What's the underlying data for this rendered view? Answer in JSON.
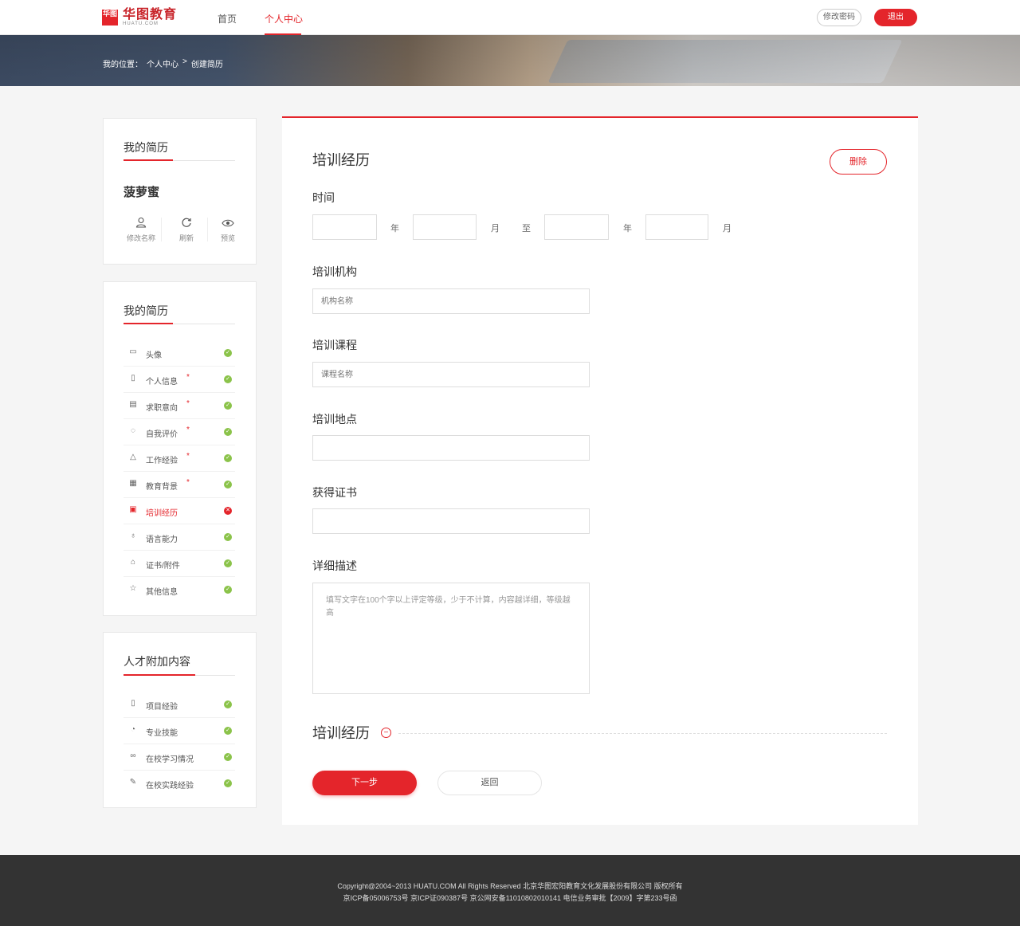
{
  "header": {
    "logo_mark": "华图",
    "logo_cn": "华图教育",
    "logo_en": "HUATU.COM",
    "nav": [
      "首页",
      "个人中心"
    ],
    "change_password": "修改密码",
    "logout": "退出"
  },
  "breadcrumb": {
    "prefix": "我的位置：",
    "level1": "个人中心",
    "sep": ">",
    "level2": "创建简历"
  },
  "profile_card": {
    "title": "我的简历",
    "username": "菠萝蜜",
    "actions": [
      {
        "label": "修改名称",
        "icon": "user-icon"
      },
      {
        "label": "刷新",
        "icon": "refresh-icon"
      },
      {
        "label": "预览",
        "icon": "eye-icon"
      }
    ]
  },
  "resume_menu": {
    "title": "我的简历",
    "items": [
      {
        "label": "头像",
        "required": false,
        "status": "ok"
      },
      {
        "label": "个人信息",
        "required": true,
        "status": "ok"
      },
      {
        "label": "求职意向",
        "required": true,
        "status": "ok"
      },
      {
        "label": "自我评价",
        "required": true,
        "status": "ok"
      },
      {
        "label": "工作经验",
        "required": true,
        "status": "ok"
      },
      {
        "label": "教育背景",
        "required": true,
        "status": "ok"
      },
      {
        "label": "培训经历",
        "required": false,
        "status": "error"
      },
      {
        "label": "语言能力",
        "required": false,
        "status": "ok"
      },
      {
        "label": "证书/附件",
        "required": false,
        "status": "ok"
      },
      {
        "label": "其他信息",
        "required": false,
        "status": "ok"
      }
    ],
    "required_mark": "*"
  },
  "extra_menu": {
    "title": "人才附加内容",
    "items": [
      {
        "label": "项目经验"
      },
      {
        "label": "专业技能"
      },
      {
        "label": "在校学习情况"
      },
      {
        "label": "在校实践经验"
      }
    ]
  },
  "form": {
    "section_title": "培训经历",
    "delete_label": "删除",
    "time_label": "时间",
    "unit_year": "年",
    "unit_month": "月",
    "unit_to": "至",
    "org_label": "培训机构",
    "org_placeholder": "机构名称",
    "course_label": "培训课程",
    "course_placeholder": "课程名称",
    "place_label": "培训地点",
    "cert_label": "获得证书",
    "desc_label": "详细描述",
    "desc_placeholder": "填写文字在100个字以上评定等级，少于不计算，内容越详细，等级越高",
    "add_section_title": "培训经历",
    "next_label": "下一步",
    "back_label": "返回"
  },
  "footer": {
    "line1": "Copyright@2004~2013 HUATU.COM All Rights Reserved 北京华图宏阳教育文化发展股份有限公司 版权所有",
    "line2": "京ICP备05006753号 京ICP证090387号 京公网安备11010802010141 电信业务审批【2009】字第233号函"
  },
  "colors": {
    "accent": "#e4252b",
    "ok": "#8bc34a",
    "footer": "#333333"
  }
}
